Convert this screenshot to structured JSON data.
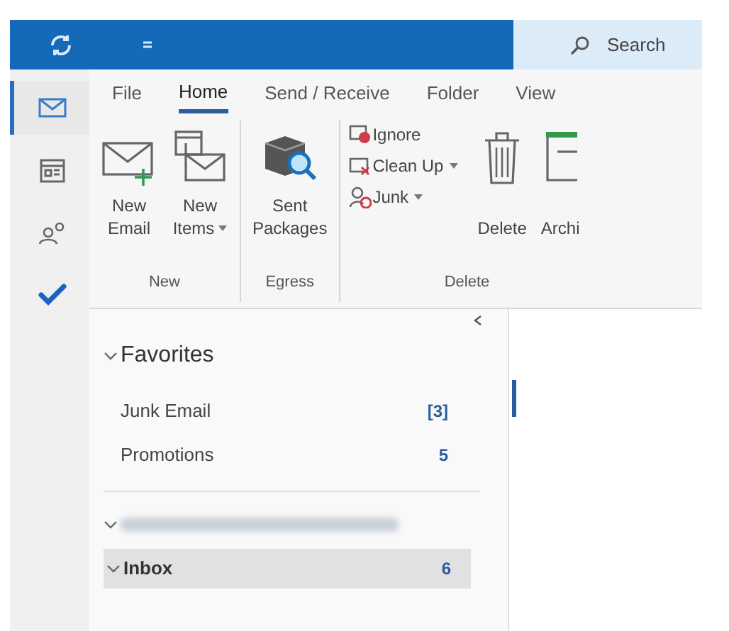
{
  "title_bar": {
    "search": {
      "placeholder": "Search"
    }
  },
  "nav_rail": [
    {
      "kind": "mail",
      "selected": true
    },
    {
      "kind": "calendar",
      "selected": false
    },
    {
      "kind": "people",
      "selected": false
    },
    {
      "kind": "todo",
      "selected": false
    }
  ],
  "tabs": [
    {
      "label": "File",
      "selected": false
    },
    {
      "label": "Home",
      "selected": true
    },
    {
      "label": "Send / Receive",
      "selected": false
    },
    {
      "label": "Folder",
      "selected": false
    },
    {
      "label": "View",
      "selected": false
    }
  ],
  "ribbon": {
    "groups": [
      {
        "label": "New",
        "buttons": [
          {
            "kind": "new-email",
            "lines": [
              "New",
              "Email"
            ],
            "dropdown": false
          },
          {
            "kind": "new-items",
            "lines": [
              "New",
              "Items"
            ],
            "dropdown": true
          }
        ]
      },
      {
        "label": "Egress",
        "buttons": [
          {
            "kind": "packages",
            "lines": [
              "Sent",
              "Packages"
            ],
            "dropdown": false
          }
        ]
      },
      {
        "label": "Delete",
        "small_buttons": [
          {
            "kind": "ignore",
            "label": "Ignore",
            "dropdown": false
          },
          {
            "kind": "clean-up",
            "label": "Clean Up",
            "dropdown": true
          },
          {
            "kind": "junk",
            "label": "Junk",
            "dropdown": true
          }
        ],
        "buttons": [
          {
            "kind": "delete",
            "lines": [
              "Delete"
            ],
            "dropdown": false
          },
          {
            "kind": "archive",
            "lines": [
              "Archi"
            ],
            "dropdown": false
          }
        ]
      }
    ]
  },
  "folder_pane": {
    "favorites": {
      "label": "Favorites",
      "expanded": true,
      "items": [
        {
          "label": "Junk Email",
          "count": "[3]"
        },
        {
          "label": "Promotions",
          "count": "5"
        }
      ]
    },
    "account": {
      "expanded": true,
      "folders": [
        {
          "label": "Inbox",
          "count": "6",
          "expanded": true,
          "selected": true
        }
      ]
    }
  }
}
